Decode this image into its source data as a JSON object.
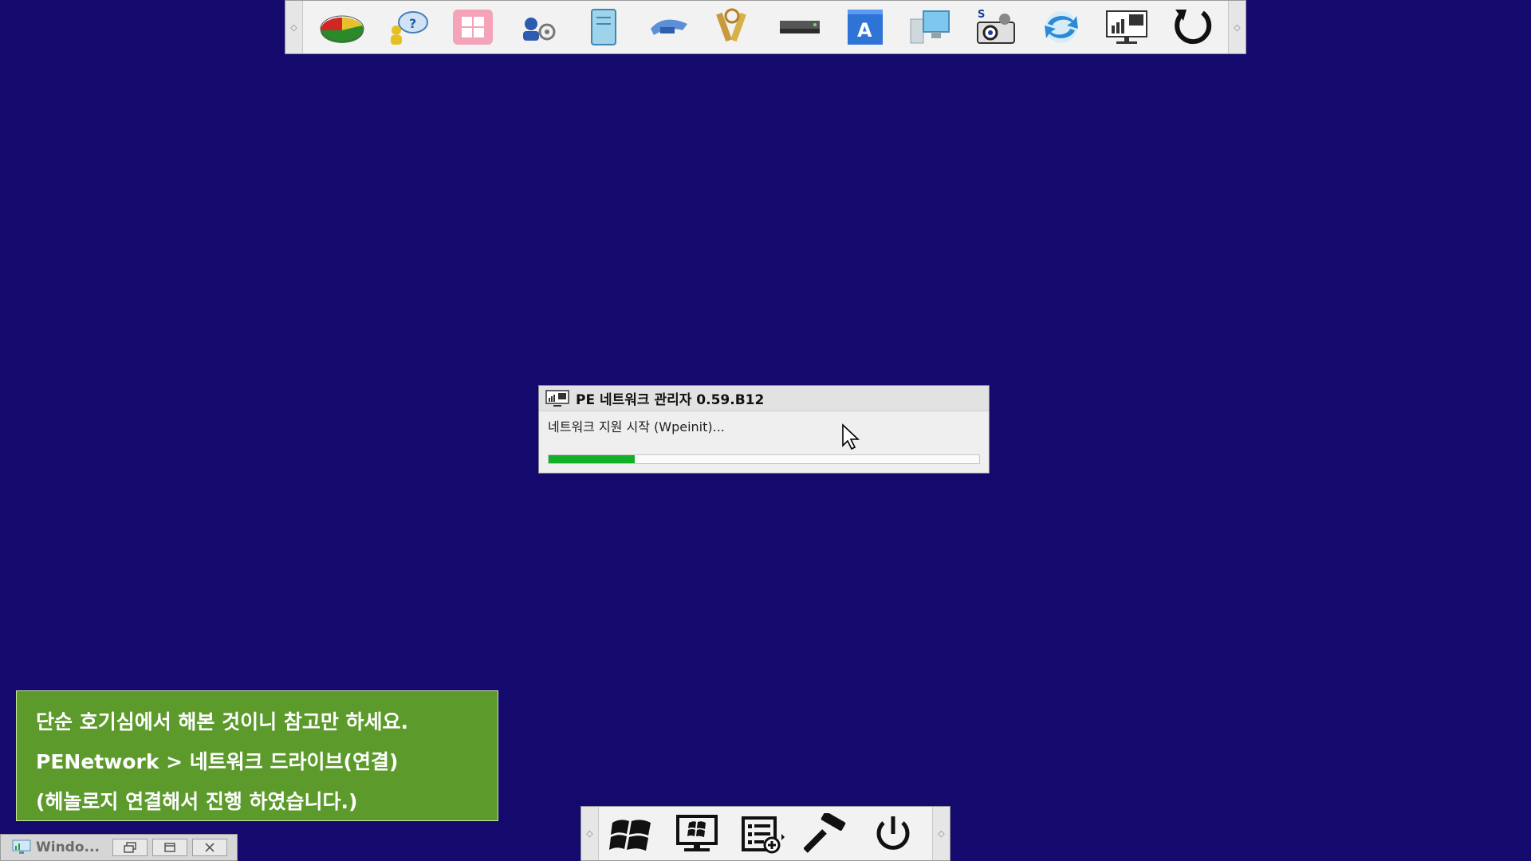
{
  "toolbar": {
    "icons": [
      "partition-disk-icon",
      "user-help-icon",
      "windows-installer-icon",
      "network-admin-icon",
      "notepad-icon",
      "key-tool-icon",
      "password-tools-icon",
      "drive-icon",
      "text-editor-icon",
      "computer-manage-icon",
      "snapshot-camera-icon",
      "sync-arrows-icon",
      "network-monitor-icon",
      "refresh-icon"
    ]
  },
  "dialog": {
    "title": "PE 네트워크 관리자 0.59.B12",
    "status": "네트워크 지원 시작 (Wpeinit)...",
    "progress_percent": 20,
    "progress_color": "#11b026"
  },
  "notice": {
    "lines": [
      "단순 호기심에서 해본 것이니 참고만 하세요.",
      "PENetwork > 네트워크 드라이브(연결)",
      "(헤놀로지 연결해서 진행 하였습니다.)"
    ],
    "background": "#5c9a2b"
  },
  "startbar": {
    "icons": [
      "windows-start-icon",
      "desktop-icon",
      "task-list-icon",
      "tools-hammer-icon",
      "power-icon"
    ]
  },
  "taskwindow": {
    "title": "Windo..."
  },
  "colors": {
    "desktop": "#140a6e"
  }
}
